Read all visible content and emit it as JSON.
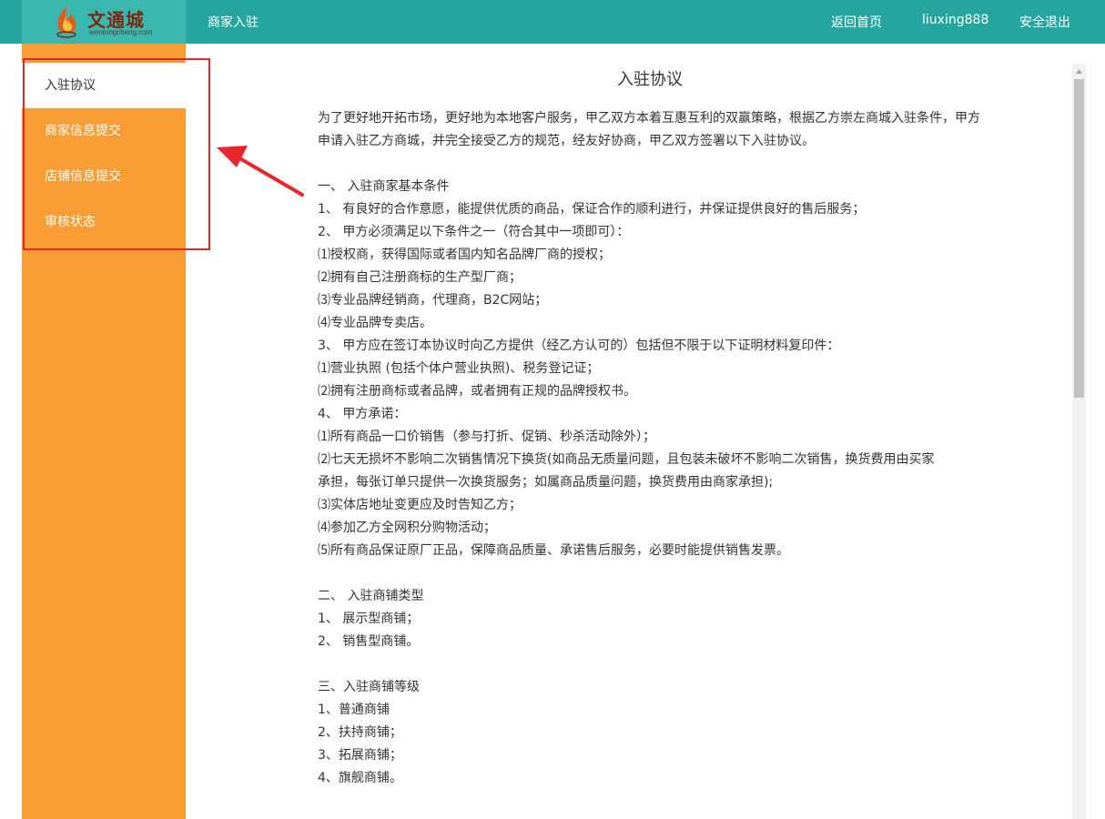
{
  "header": {
    "logo_name": "文通城",
    "logo_domain": "wentongcheng.com",
    "nav_title": "商家入驻",
    "home_link": "返回首页",
    "username": "liuxing888",
    "logout": "安全退出"
  },
  "sidebar": {
    "items": [
      {
        "label": "入驻协议",
        "active": true
      },
      {
        "label": "商家信息提交",
        "active": false
      },
      {
        "label": "店铺信息提交",
        "active": false
      },
      {
        "label": "审核状态",
        "active": false
      }
    ]
  },
  "agreement": {
    "title": "入驻协议",
    "intro": "为了更好地开拓市场，更好地为本地客户服务，甲乙双方本着互惠互利的双赢策略，根据乙方崇左商城入驻条件，甲方申请入驻乙方商城，并完全接受乙方的规范，经友好协商，甲乙双方签署以下入驻协议。",
    "section1": {
      "heading": "一、 入驻商家基本条件",
      "lines": [
        "1、 有良好的合作意愿，能提供优质的商品，保证合作的顺利进行，并保证提供良好的售后服务；",
        "2、 甲方必须满足以下条件之一（符合其中一项即可）：",
        "⑴授权商，获得国际或者国内知名品牌厂商的授权；",
        "⑵拥有自己注册商标的生产型厂商；",
        "⑶专业品牌经销商，代理商，B2C网站；",
        "⑷专业品牌专卖店。",
        "3、 甲方应在签订本协议时向乙方提供（经乙方认可的）包括但不限于以下证明材料复印件：",
        "⑴营业执照 (包括个体户营业执照)、税务登记证；",
        "⑵拥有注册商标或者品牌，或者拥有正规的品牌授权书。",
        "4、 甲方承诺：",
        "⑴所有商品一口价销售（参与打折、促销、秒杀活动除外）；",
        "⑵七天无损坏不影响二次销售情况下换货(如商品无质量问题，且包装未破坏不影响二次销售，换货费用由买家",
        "承担，每张订单只提供一次换货服务；如属商品质量问题，换货费用由商家承担);",
        "⑶实体店地址变更应及时告知乙方；",
        "⑷参加乙方全网积分购物活动；",
        "⑸所有商品保证原厂正品，保障商品质量、承诺售后服务，必要时能提供销售发票。"
      ]
    },
    "section2": {
      "heading": "二、 入驻商铺类型",
      "lines": [
        "1、 展示型商铺；",
        "2、 销售型商铺。"
      ]
    },
    "section3": {
      "heading": "三、入驻商铺等级",
      "lines": [
        "1、普通商铺",
        "2、扶持商铺；",
        "3、拓展商铺；",
        "4、旗舰商铺。"
      ]
    }
  },
  "colors": {
    "header_bg": "#25a59e",
    "logo_bg": "#3ab8b0",
    "sidebar_bg": "#f89c34",
    "highlight": "#e8262b"
  }
}
